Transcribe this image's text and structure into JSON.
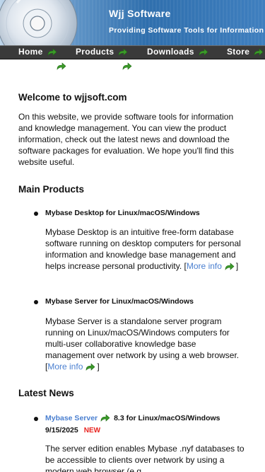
{
  "header": {
    "title": "Wjj Software",
    "tagline": "Providing Software Tools for Information and Knowledge Management"
  },
  "nav": [
    {
      "label": "Home"
    },
    {
      "label": "Products"
    },
    {
      "label": "Downloads"
    },
    {
      "label": "Store"
    }
  ],
  "welcome": {
    "heading": "Welcome to wjjsoft.com",
    "body": "On this website, we provide software tools for information and knowledge management. You can view the product information, check out the latest news and download the software packages for evaluation. We hope you'll find this website useful."
  },
  "products": {
    "heading": "Main Products",
    "items": [
      {
        "title": "Mybase Desktop for Linux/macOS/Windows",
        "description": "Mybase Desktop is an intuitive free-form database software running on desktop computers for personal information and knowledge base management and helps increase personal productivity.",
        "more_label": "More info"
      },
      {
        "title": "Mybase Server for Linux/macOS/Windows",
        "description": "Mybase Server is a standalone server program running on Linux/macOS/Windows computers for multi-user collaborative knowledge base management over network by using a web browser.",
        "more_label": "More info"
      }
    ]
  },
  "news": {
    "heading": "Latest News",
    "items": [
      {
        "link_label": "Mybase Server",
        "title_rest": "8.3 for Linux/macOS/Windows",
        "date": "9/15/2025",
        "badge": "NEW",
        "description": "The server edition enables Mybase .nyf databases to be accessible to clients over network by using a modern web browser (e.g."
      }
    ]
  },
  "colors": {
    "link": "#4a7fd0",
    "badge": "#e8231f",
    "nav_bg": "#3a3a3a",
    "arrow_green": "#3c9a2a"
  },
  "icons": {
    "nav_arrow": "green-arrow-icon",
    "logo": "disc-logo"
  }
}
